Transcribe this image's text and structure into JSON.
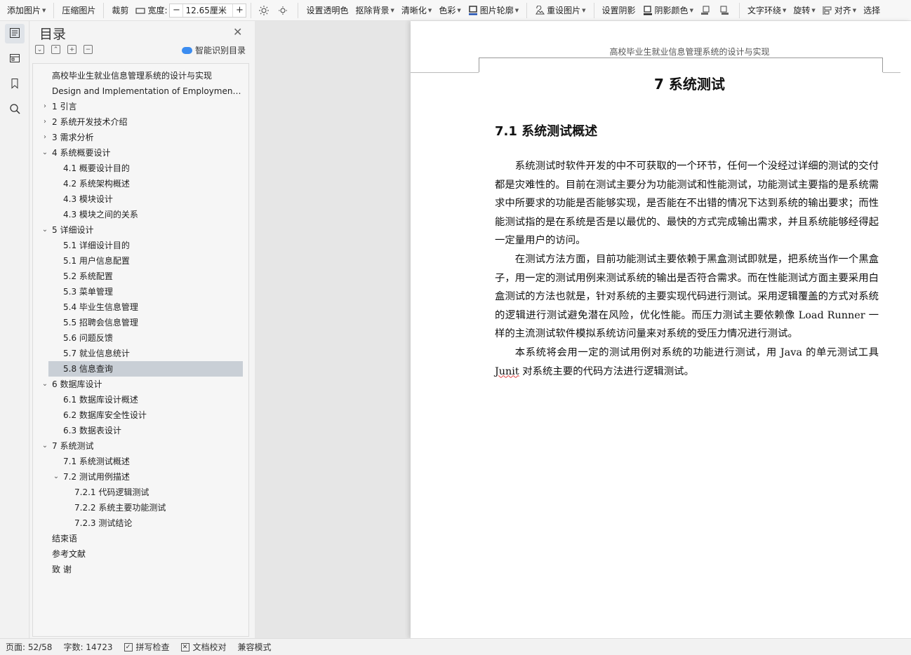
{
  "ribbon": {
    "add_image": "添加图片",
    "compress_image": "压缩图片",
    "crop": "裁剪",
    "width_label": "宽度:",
    "width_value": "12.65厘米",
    "set_transparent": "设置透明色",
    "remove_background": "抠除背景",
    "sharpen": "清晰化",
    "color": "色彩",
    "image_outline": "图片轮廓",
    "reset_image": "重设图片",
    "set_shadow": "设置阴影",
    "shadow_color": "阴影颜色",
    "text_wrap": "文字环绕",
    "rotate": "旋转",
    "align": "对齐",
    "select": "选择"
  },
  "rail": {
    "icons": [
      "outline-icon",
      "navigation-tree-icon",
      "bookmark-icon",
      "search-icon"
    ]
  },
  "toc": {
    "title": "目录",
    "smart_identify": "智能识别目录",
    "items": [
      {
        "indent": 0,
        "chev": "",
        "label": "高校毕业生就业信息管理系统的设计与实现"
      },
      {
        "indent": 0,
        "chev": "",
        "label": "Design and Implementation of Employment..."
      },
      {
        "indent": 0,
        "chev": "›",
        "label": "1   引言"
      },
      {
        "indent": 0,
        "chev": "›",
        "label": "2   系统开发技术介绍"
      },
      {
        "indent": 0,
        "chev": "›",
        "label": "3    需求分析"
      },
      {
        "indent": 0,
        "chev": "⌄",
        "label": "4   系统概要设计"
      },
      {
        "indent": 1,
        "chev": "",
        "label": "4.1  概要设计目的"
      },
      {
        "indent": 1,
        "chev": "",
        "label": "4.2  系统架构概述"
      },
      {
        "indent": 1,
        "chev": "",
        "label": "4.3  模块设计"
      },
      {
        "indent": 1,
        "chev": "",
        "label": "4.3  模块之间的关系"
      },
      {
        "indent": 0,
        "chev": "⌄",
        "label": "5  详细设计"
      },
      {
        "indent": 1,
        "chev": "",
        "label": "5.1  详细设计目的"
      },
      {
        "indent": 1,
        "chev": "",
        "label": "5.1  用户信息配置"
      },
      {
        "indent": 1,
        "chev": "",
        "label": "5.2  系统配置"
      },
      {
        "indent": 1,
        "chev": "",
        "label": "5.3  菜单管理"
      },
      {
        "indent": 1,
        "chev": "",
        "label": "5.4  毕业生信息管理"
      },
      {
        "indent": 1,
        "chev": "",
        "label": "5.5  招聘会信息管理"
      },
      {
        "indent": 1,
        "chev": "",
        "label": "5.6  问题反馈"
      },
      {
        "indent": 1,
        "chev": "",
        "label": "5.7  就业信息统计"
      },
      {
        "indent": 1,
        "chev": "",
        "label": "5.8  信息查询",
        "selected": true
      },
      {
        "indent": 0,
        "chev": "⌄",
        "label": "6  数据库设计"
      },
      {
        "indent": 1,
        "chev": "",
        "label": "6.1  数据库设计概述"
      },
      {
        "indent": 1,
        "chev": "",
        "label": "6.2  数据库安全性设计"
      },
      {
        "indent": 1,
        "chev": "",
        "label": "6.3 数据表设计"
      },
      {
        "indent": 0,
        "chev": "⌄",
        "label": "7  系统测试"
      },
      {
        "indent": 1,
        "chev": "",
        "label": "7.1  系统测试概述"
      },
      {
        "indent": 1,
        "chev": "⌄",
        "label": "7.2  测试用例描述"
      },
      {
        "indent": 2,
        "chev": "",
        "label": "7.2.1  代码逻辑测试"
      },
      {
        "indent": 2,
        "chev": "",
        "label": "7.2.2  系统主要功能测试"
      },
      {
        "indent": 2,
        "chev": "",
        "label": "7.2.3  测试结论"
      },
      {
        "indent": 0,
        "chev": "",
        "label": "结束语"
      },
      {
        "indent": 0,
        "chev": "",
        "label": "参考文献"
      },
      {
        "indent": 0,
        "chev": "",
        "label": "致    谢"
      }
    ]
  },
  "document": {
    "header": "高校毕业生就业信息管理系统的设计与实现",
    "chapter_title": "7  系统测试",
    "section_title": "7.1  系统测试概述",
    "paragraphs": [
      "系统测试时软件开发的中不可获取的一个环节，任何一个没经过详细的测试的交付都是灾难性的。目前在测试主要分为功能测试和性能测试，功能测试主要指的是系统需求中所要求的功能是否能够实现，是否能在不出错的情况下达到系统的输出要求；而性能测试指的是在系统是否是以最优的、最快的方式完成输出需求，并且系统能够经得起一定量用户的访问。",
      "在测试方法方面，目前功能测试主要依赖于黑盒测试即就是，把系统当作一个黑盒子，用一定的测试用例来测试系统的输出是否符合需求。而在性能测试方面主要采用白盒测试的方法也就是，针对系统的主要实现代码进行测试。采用逻辑覆盖的方式对系统的逻辑进行测试避免潜在风险，优化性能。而压力测试主要依赖像 Load Runner 一样的主流测试软件模拟系统访问量来对系统的受压力情况进行测试。"
    ],
    "para3_a": "本系统将会用一定的测试用例对系统的功能进行测试，用 Java 的单元测试工具 ",
    "para3_junit": "Junit",
    "para3_b": " 对系统主要的代码方法进行逻辑测试。"
  },
  "status": {
    "page": "页面: 52/58",
    "words": "字数: 14723",
    "spell_check": "拼写检查",
    "doc_proof": "文档校对",
    "compat_mode": "兼容模式"
  }
}
